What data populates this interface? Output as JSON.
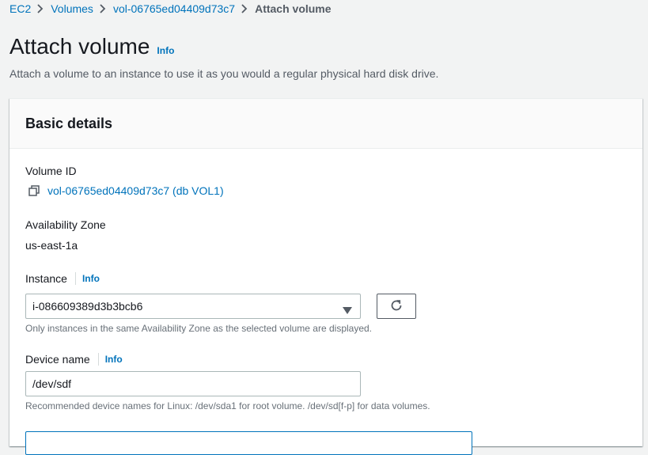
{
  "breadcrumb": {
    "items": [
      "EC2",
      "Volumes",
      "vol-06765ed04409d73c7"
    ],
    "current": "Attach volume"
  },
  "page": {
    "title": "Attach volume",
    "info": "Info",
    "description": "Attach a volume to an instance to use it as you would a regular physical hard disk drive."
  },
  "panel": {
    "title": "Basic details",
    "volume_id": {
      "label": "Volume ID",
      "value": "vol-06765ed04409d73c7 (db VOL1)"
    },
    "availability_zone": {
      "label": "Availability Zone",
      "value": "us-east-1a"
    },
    "instance": {
      "label": "Instance",
      "info": "Info",
      "selected": "i-086609389d3b3bcb6",
      "hint": "Only instances in the same Availability Zone as the selected volume are displayed."
    },
    "device_name": {
      "label": "Device name",
      "info": "Info",
      "value": "/dev/sdf",
      "hint": "Recommended device names for Linux: /dev/sda1 for root volume. /dev/sd[f-p] for data volumes."
    }
  },
  "colors": {
    "link": "#0073bb",
    "background": "#f2f3f3",
    "text": "#16191f",
    "muted": "#687078"
  },
  "icons": {
    "breadcrumb_separator": "chevron-right-icon",
    "copy": "copy-icon",
    "dropdown": "caret-down-icon",
    "refresh": "refresh-icon"
  }
}
